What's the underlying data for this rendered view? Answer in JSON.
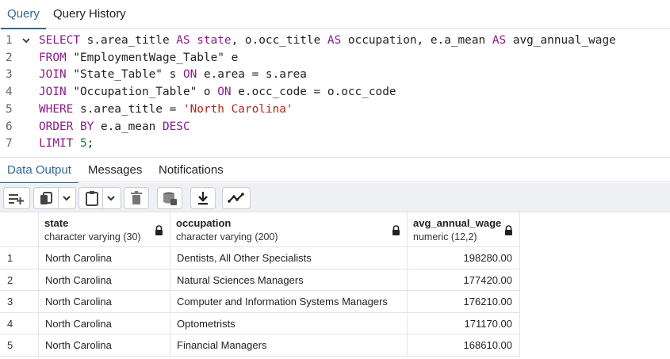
{
  "top_tabs": [
    {
      "label": "Query",
      "active": true
    },
    {
      "label": "Query History",
      "active": false
    }
  ],
  "editor": {
    "lines": [
      {
        "n": "1",
        "tokens": [
          [
            "kw",
            "SELECT"
          ],
          [
            "t",
            " s.area_title "
          ],
          [
            "kw",
            "AS"
          ],
          [
            "t",
            " "
          ],
          [
            "kw",
            "state"
          ],
          [
            "t",
            ", o.occ_title "
          ],
          [
            "kw",
            "AS"
          ],
          [
            "t",
            " occupation, e.a_mean "
          ],
          [
            "kw",
            "AS"
          ],
          [
            "t",
            " avg_annual_wage"
          ]
        ]
      },
      {
        "n": "2",
        "tokens": [
          [
            "kw",
            "FROM"
          ],
          [
            "t",
            " \"EmploymentWage_Table\" e"
          ]
        ]
      },
      {
        "n": "3",
        "tokens": [
          [
            "kw",
            "JOIN"
          ],
          [
            "t",
            " \"State_Table\" s "
          ],
          [
            "kw",
            "ON"
          ],
          [
            "t",
            " e.area = s.area"
          ]
        ]
      },
      {
        "n": "4",
        "tokens": [
          [
            "kw",
            "JOIN"
          ],
          [
            "t",
            " \"Occupation_Table\" o "
          ],
          [
            "kw",
            "ON"
          ],
          [
            "t",
            " e.occ_code = o.occ_code"
          ]
        ]
      },
      {
        "n": "5",
        "tokens": [
          [
            "kw",
            "WHERE"
          ],
          [
            "t",
            " s.area_title = "
          ],
          [
            "str",
            "'North Carolina'"
          ]
        ]
      },
      {
        "n": "6",
        "tokens": [
          [
            "kw",
            "ORDER BY"
          ],
          [
            "t",
            " e.a_mean "
          ],
          [
            "kw",
            "DESC"
          ]
        ]
      },
      {
        "n": "7",
        "tokens": [
          [
            "kw",
            "LIMIT"
          ],
          [
            "t",
            " "
          ],
          [
            "num",
            "5"
          ],
          [
            "t",
            ";"
          ]
        ]
      }
    ]
  },
  "lower_tabs": [
    {
      "label": "Data Output",
      "active": true
    },
    {
      "label": "Messages",
      "active": false
    },
    {
      "label": "Notifications",
      "active": false
    }
  ],
  "toolbar": {
    "icons": [
      "add-row-icon",
      "copy-icon",
      "chevron-down-icon",
      "paste-icon",
      "chevron-down-icon",
      "delete-icon",
      "save-data-icon",
      "download-icon",
      "graph-icon"
    ]
  },
  "grid": {
    "columns": [
      {
        "name": "state",
        "type": "character varying (30)"
      },
      {
        "name": "occupation",
        "type": "character varying (200)"
      },
      {
        "name": "avg_annual_wage",
        "type": "numeric (12,2)"
      }
    ],
    "rows": [
      {
        "n": "1",
        "state": "North Carolina",
        "occupation": "Dentists, All Other Specialists",
        "wage": "198280.00"
      },
      {
        "n": "2",
        "state": "North Carolina",
        "occupation": "Natural Sciences Managers",
        "wage": "177420.00"
      },
      {
        "n": "3",
        "state": "North Carolina",
        "occupation": "Computer and Information Systems Managers",
        "wage": "176210.00"
      },
      {
        "n": "4",
        "state": "North Carolina",
        "occupation": "Optometrists",
        "wage": "171170.00"
      },
      {
        "n": "5",
        "state": "North Carolina",
        "occupation": "Financial Managers",
        "wage": "168610.00"
      }
    ]
  }
}
